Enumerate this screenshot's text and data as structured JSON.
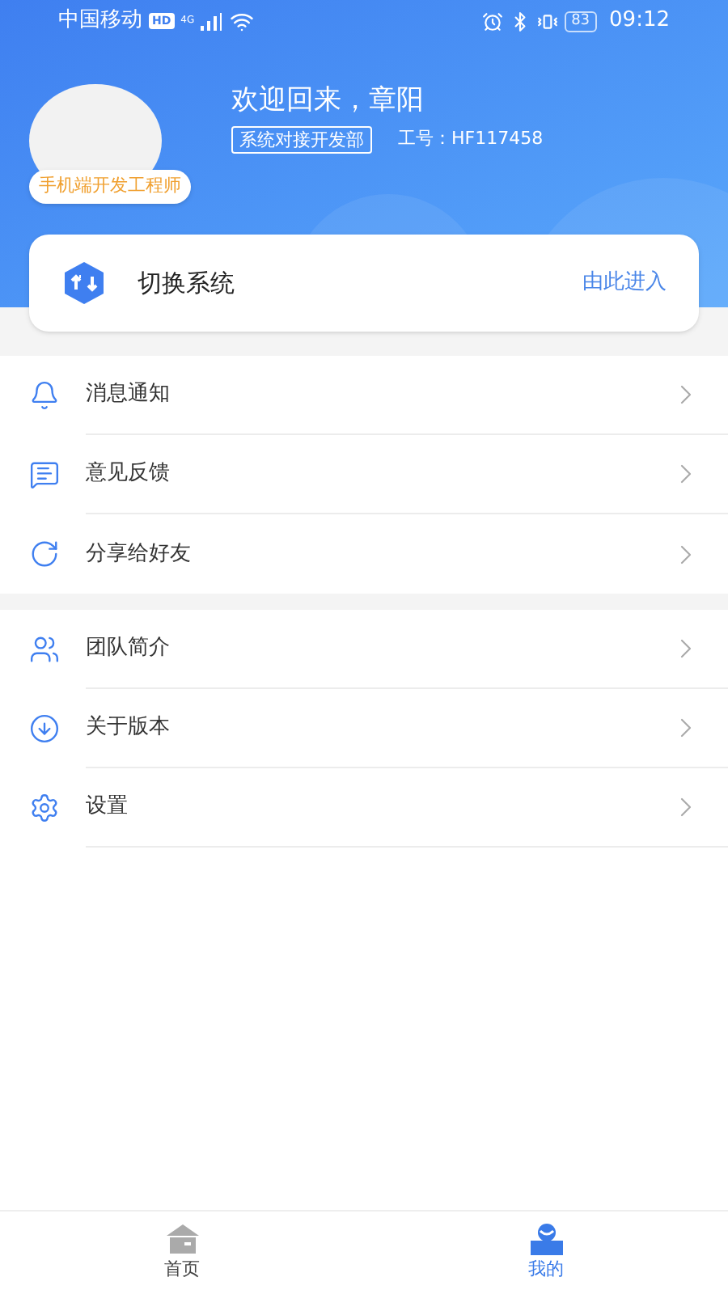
{
  "status_bar": {
    "carrier": "中国移动",
    "hd": "HD",
    "network": "4G",
    "battery": "83",
    "time": "09:12"
  },
  "profile": {
    "greeting": "欢迎回来，章阳",
    "role": "手机端开发工程师",
    "department": "系统对接开发部",
    "employee_id": "工号：HF117458"
  },
  "switch_card": {
    "title": "切换系统",
    "action": "由此进入"
  },
  "menu_groups": [
    [
      {
        "label": "消息通知"
      },
      {
        "label": "意见反馈"
      },
      {
        "label": "分享给好友"
      }
    ],
    [
      {
        "label": "团队简介"
      },
      {
        "label": "关于版本"
      },
      {
        "label": "设置"
      }
    ]
  ],
  "tabs": [
    {
      "label": "首页",
      "selected": false
    },
    {
      "label": "我的",
      "selected": true
    }
  ]
}
